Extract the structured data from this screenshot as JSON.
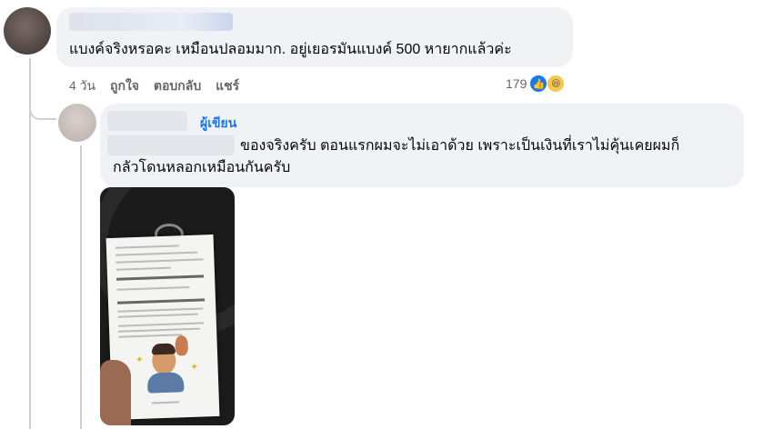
{
  "comment1": {
    "text": "แบงค์จริงหรอคะ เหมือนปลอมมาก. อยู่เยอรมันแบงค์ 500 หายากแล้วค่ะ",
    "time": "4 วัน",
    "like_label": "ถูกใจ",
    "reply_label": "ตอบกลับ",
    "share_label": "แชร์",
    "reaction_count": "179",
    "reaction_icons": [
      "like-icon",
      "haha-icon"
    ]
  },
  "reply1": {
    "author_badge": "ผู้เขียน",
    "line1": "ของจริงครับ ตอนแรกผมจะไม่เอาด้วย เพราะเป็นเงินที่เราไม่คุ้นเคยผมก็",
    "line2": "กลัวโดนหลอกเหมือนกันครับ",
    "photo_icon": "receipt-photo"
  },
  "colors": {
    "bubble": "#f0f2f5",
    "author": "#1877f2",
    "meta": "#65676b"
  }
}
